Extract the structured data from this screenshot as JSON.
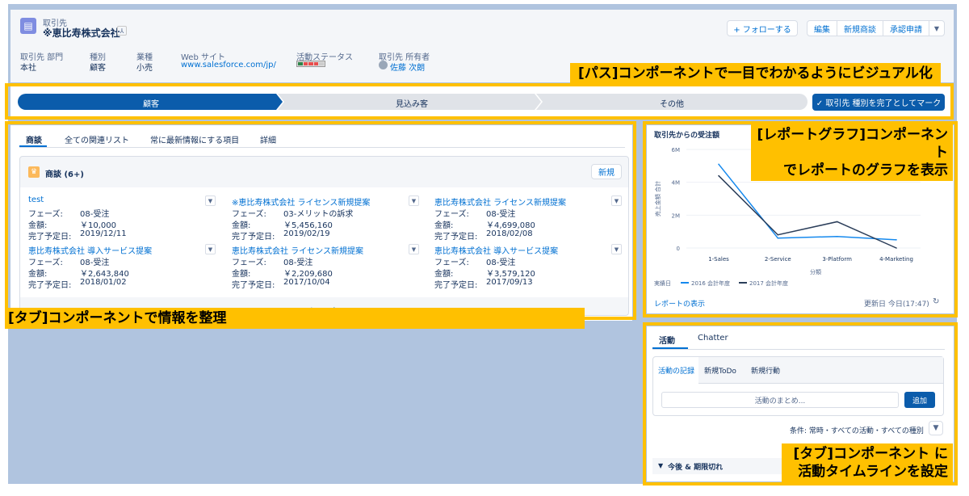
{
  "header": {
    "object_label": "取引先",
    "record_name": "※恵比寿株式会社",
    "hierarchy_icon": "hierarchy-icon",
    "follow_label": "+ フォローする",
    "edit_label": "編集",
    "new_deal_label": "新規商談",
    "approval_label": "承認申請",
    "fields": [
      {
        "label": "取引先 部門",
        "value": "本社"
      },
      {
        "label": "種別",
        "value": "顧客"
      },
      {
        "label": "業種",
        "value": "小売"
      },
      {
        "label": "Web サイト",
        "value": "www.salesforce.com/jp/"
      },
      {
        "label": "活動ステータス",
        "value": ""
      },
      {
        "label": "取引先 所有者",
        "value": "佐藤 次朗"
      }
    ]
  },
  "path": {
    "stages": [
      "顧客",
      "見込み客",
      "その他"
    ],
    "complete_label": "✓ 取引先 種別を完了としてマーク"
  },
  "tabs": {
    "items": [
      "商談",
      "全ての関連リスト",
      "常に最新情報にする項目",
      "詳細"
    ]
  },
  "opportunities": {
    "title": "商談 (6+)",
    "new_label": "新規",
    "labels": {
      "phase": "フェーズ:",
      "amount": "金額:",
      "close": "完了予定日:"
    },
    "items": [
      {
        "name": "test",
        "phase": "08-受注",
        "amount": "￥10,000",
        "close": "2019/12/11"
      },
      {
        "name": "※恵比寿株式会社 ライセンス新規提案",
        "phase": "03-メリットの訴求",
        "amount": "￥5,456,160",
        "close": "2019/02/19"
      },
      {
        "name": "恵比寿株式会社 ライセンス新規提案",
        "phase": "08-受注",
        "amount": "￥4,699,080",
        "close": "2018/02/08"
      },
      {
        "name": "恵比寿株式会社 導入サービス提案",
        "phase": "08-受注",
        "amount": "￥2,643,840",
        "close": "2018/01/02"
      },
      {
        "name": "恵比寿株式会社 ライセンス新規提案",
        "phase": "08-受注",
        "amount": "￥2,209,680",
        "close": "2017/10/04"
      },
      {
        "name": "恵比寿株式会社 導入サービス提案",
        "phase": "08-受注",
        "amount": "￥3,579,120",
        "close": "2017/09/13"
      }
    ],
    "view_all": "すべて表示"
  },
  "chart_panel": {
    "title": "取引先からの受注額",
    "view_report": "レポートの表示",
    "updated": "更新日 今日(17:47)",
    "legend_prefix": "実績日"
  },
  "chart_data": {
    "type": "line",
    "categories": [
      "1-Sales",
      "2-Service",
      "3-Platform",
      "4-Marketing"
    ],
    "xlabel": "分類",
    "ylabel": "売上金額 合計",
    "ylim": [
      0,
      6
    ],
    "yticks": [
      "0",
      "2M",
      "4M",
      "6M"
    ],
    "series": [
      {
        "name": "2016 会計年度",
        "color": "#1589ee",
        "values": [
          5.1,
          0.6,
          0.7,
          0.5
        ]
      },
      {
        "name": "2017 会計年度",
        "color": "#2b3e5a",
        "values": [
          4.4,
          0.8,
          1.6,
          0.0
        ]
      }
    ]
  },
  "activity": {
    "tabs": [
      "活動",
      "Chatter"
    ],
    "subtabs": [
      "活動の記録",
      "新規ToDo",
      "新規行動"
    ],
    "input_placeholder": "活動のまとめ...",
    "add_label": "追加",
    "filter_text": "条件: 常時・すべての活動・すべての種別",
    "section": "今後 & 期限切れ"
  },
  "annotations": {
    "path": "[パス]コンポーネントで一目でわかるようにビジュアル化",
    "tabs": "[タブ]コンポーネントで情報を整理",
    "chart_line1": "[レポートグラフ]コンポーネント",
    "chart_line2": "でレポートのグラフを表示",
    "activity_line1": "[タブ]コンポーネント に",
    "activity_line2": "活動タイムラインを設定"
  }
}
